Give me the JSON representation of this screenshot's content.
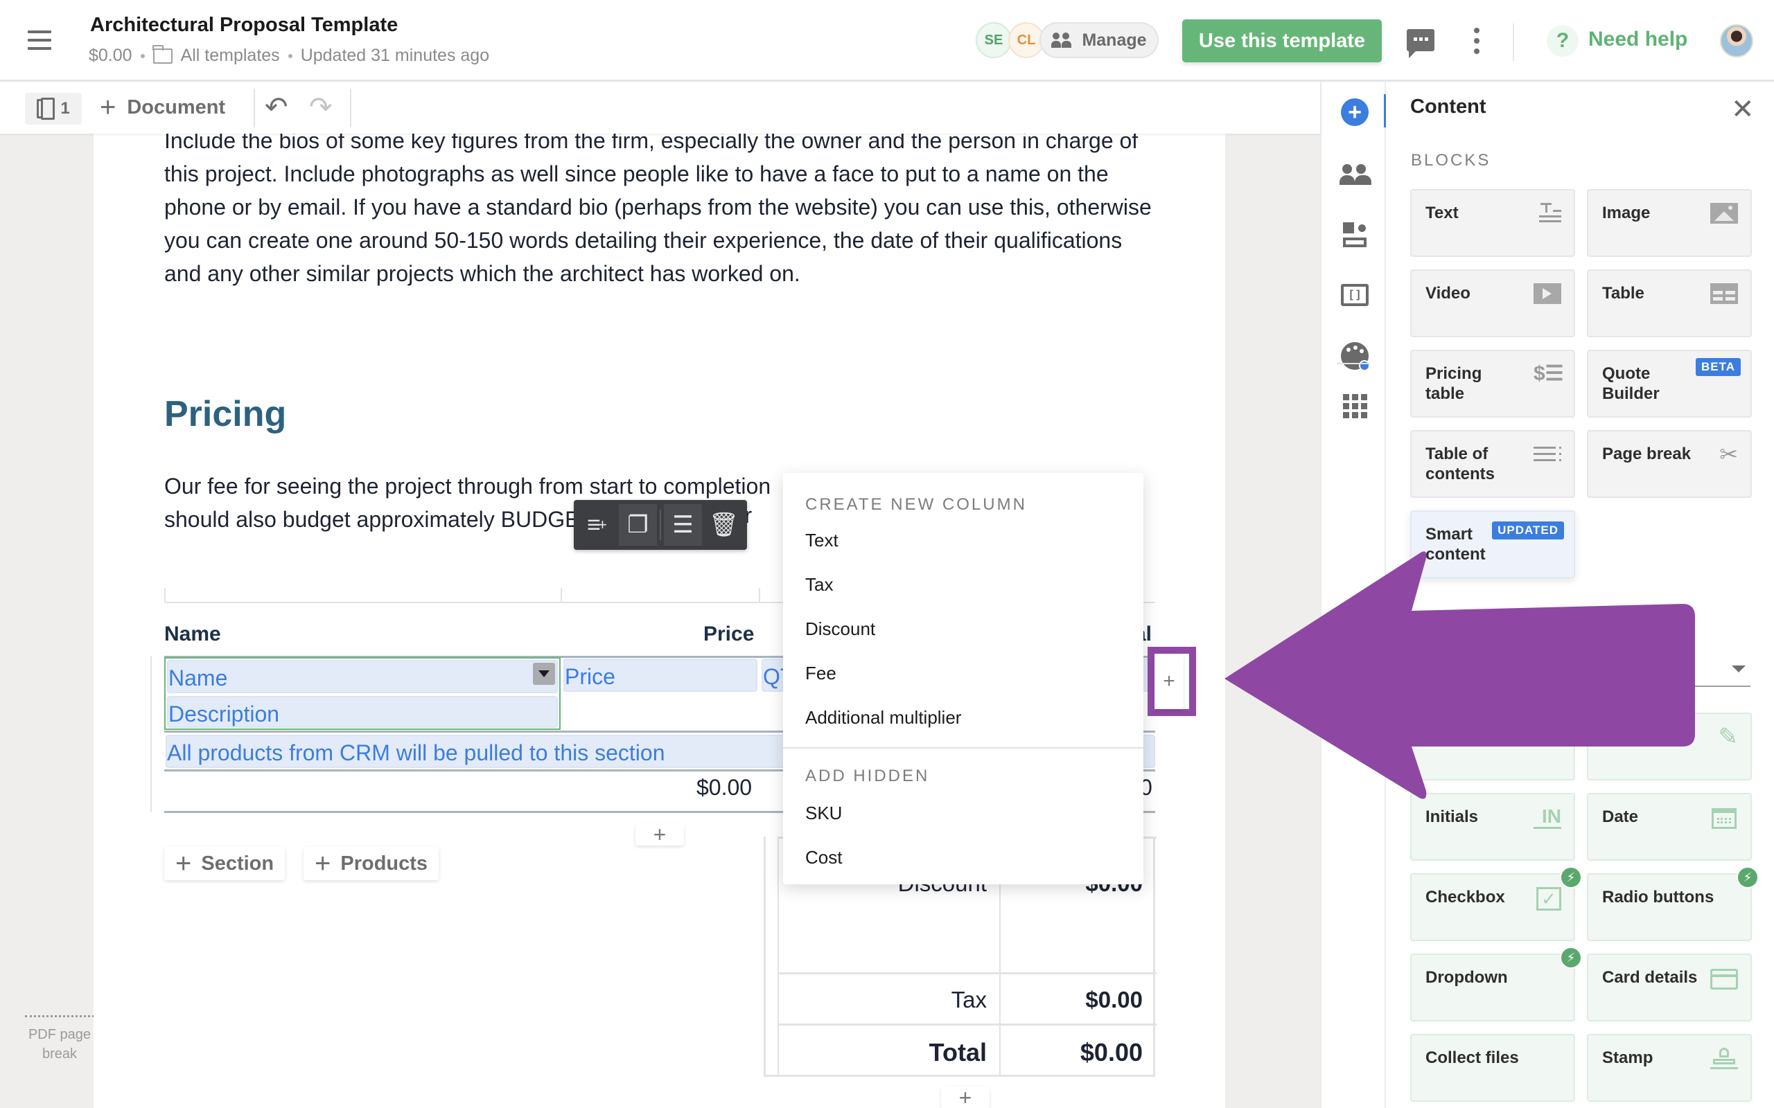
{
  "header": {
    "title": "Architectural Proposal Template",
    "price": "$0.00",
    "folder": "All templates",
    "updated": "Updated 31 minutes ago",
    "collaborators": [
      "SE",
      "CL"
    ],
    "manage_label": "Manage",
    "use_template_label": "Use this template",
    "need_help_label": "Need help",
    "help_glyph": "?"
  },
  "toolbar": {
    "page_count": "1",
    "add_document_label": "Document",
    "plus_glyph": "+"
  },
  "document": {
    "bio_paragraph_lines": [
      "Include the bios of some key figures from the firm, especially the owner and the person in charge of",
      "this project. Include photographs as well since people like to have a face to put to a name on the",
      "phone or by email. If you have a standard bio (perhaps from the website) you can use this, otherwise",
      "you can create one around 50-150 words detailing their experience, the date of their qualifications",
      "and any other similar projects which the architect has worked on."
    ],
    "pricing_heading": "Pricing",
    "fee_paragraph_lines": [
      "Our fee for seeing the project through from start to completion",
      "should also budget approximately BUDGE",
      "ater"
    ],
    "pdf_page_break": "PDF page break"
  },
  "pricing_table": {
    "headers": {
      "name": "Name",
      "price": "Price",
      "total_partial": "al"
    },
    "row_tokens": {
      "name": "Name",
      "description": "Description",
      "price": "Price",
      "qty_partial": "QT"
    },
    "crm_note": "All products from CRM will be pulled to this section",
    "subtotal": "$0.00",
    "subtotal_partial": "0",
    "add_section_label": "Section",
    "add_products_label": "Products",
    "plus_glyph": "+"
  },
  "summary_table": {
    "rows": [
      {
        "label": "Discount",
        "value": "$0.00"
      },
      {
        "label": "Tax",
        "value": "$0.00"
      },
      {
        "label": "Total",
        "value": "$0.00"
      }
    ]
  },
  "column_menu": {
    "create_heading": "CREATE NEW COLUMN",
    "create_items": [
      "Text",
      "Tax",
      "Discount",
      "Fee",
      "Additional multiplier"
    ],
    "hidden_heading": "ADD HIDDEN",
    "hidden_items": [
      "SKU",
      "Cost"
    ]
  },
  "panel": {
    "title": "Content",
    "close_glyph": "✕",
    "blocks_label": "BLOCKS",
    "blocks": [
      {
        "label": "Text",
        "icon": "text-block-icon"
      },
      {
        "label": "Image",
        "icon": "image-icon"
      },
      {
        "label": "Video",
        "icon": "video-icon"
      },
      {
        "label": "Table",
        "icon": "table-icon"
      },
      {
        "label": "Pricing table",
        "icon": "pricing-table-icon"
      },
      {
        "label": "Quote Builder",
        "icon": "quote-builder-icon",
        "badge": "BETA"
      },
      {
        "label": "Table of contents",
        "icon": "toc-icon"
      },
      {
        "label": "Page break",
        "icon": "scissors-icon"
      },
      {
        "label": "Smart content",
        "icon": "",
        "badge": "UPDATED"
      }
    ],
    "fields": [
      {
        "label": "Initials",
        "icon": "initials-icon"
      },
      {
        "label": "Date",
        "icon": "calendar-icon"
      },
      {
        "label": "Checkbox",
        "icon": "checkbox-icon",
        "bolt": true
      },
      {
        "label": "Radio buttons",
        "icon": "",
        "bolt": true
      },
      {
        "label": "Dropdown",
        "icon": "",
        "bolt": true
      },
      {
        "label": "Card details",
        "icon": "credit-card-icon"
      },
      {
        "label": "Collect files",
        "icon": ""
      },
      {
        "label": "Stamp",
        "icon": "stamp-icon"
      }
    ]
  },
  "colors": {
    "brand_green": "#67b679",
    "accent_blue": "#3b7de0",
    "heading_teal": "#2d6180",
    "annotation_purple": "#8e48a3"
  }
}
